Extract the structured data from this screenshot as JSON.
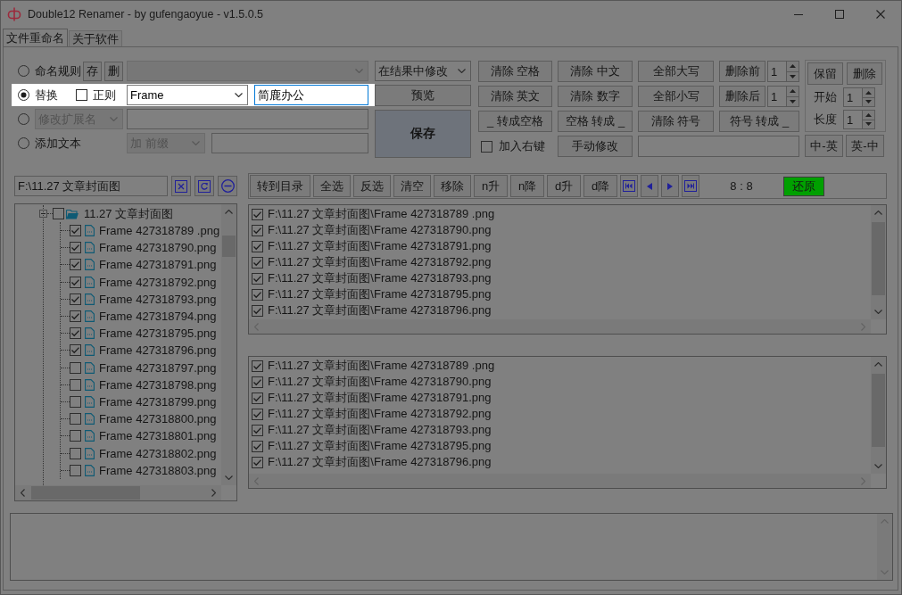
{
  "window": {
    "title": "Double12 Renamer - by gufengaoyue - v1.5.0.5"
  },
  "tabs": [
    {
      "label": "文件重命名",
      "selected": true
    },
    {
      "label": "关于软件",
      "selected": false
    }
  ],
  "rules": [
    {
      "kind": "preset",
      "label": "命名规则",
      "selected": false,
      "highlighted": false,
      "buttons": [
        "存",
        "删"
      ],
      "combo": {
        "disabled": true
      }
    },
    {
      "kind": "replace",
      "label": "替换",
      "selected": true,
      "highlighted": true,
      "regex": {
        "label": "正则",
        "checked": false
      },
      "find": {
        "value": "Frame"
      },
      "replace_with": {
        "value": "简鹿办公",
        "focused": true
      }
    },
    {
      "kind": "extension",
      "selected": false,
      "highlighted": false,
      "mode": {
        "value": "修改扩展名",
        "disabled": true
      }
    },
    {
      "kind": "add_text",
      "label": "添加文本",
      "selected": false,
      "highlighted": false,
      "position": {
        "value": "加 前缀",
        "disabled": true
      }
    }
  ],
  "scope": {
    "value": "在结果中修改"
  },
  "preview_button": {
    "label": "预览"
  },
  "save_button": {
    "label": "保存"
  },
  "actions": [
    {
      "kind": "button",
      "label": "清除 空格"
    },
    {
      "kind": "button",
      "label": "清除 中文"
    },
    {
      "kind": "button",
      "label": "全部大写"
    },
    {
      "kind": "spin_button",
      "label": "删除前",
      "value": "1"
    },
    {
      "kind": "button",
      "label": "清除 英文"
    },
    {
      "kind": "button",
      "label": "清除 数字"
    },
    {
      "kind": "button",
      "label": "全部小写"
    },
    {
      "kind": "spin_button",
      "label": "删除后",
      "value": "1"
    },
    {
      "kind": "button",
      "label": "_ 转成空格"
    },
    {
      "kind": "button",
      "label": "空格 转成 _"
    },
    {
      "kind": "button",
      "label": "清除 符号"
    },
    {
      "kind": "button",
      "label": "符号 转成 _"
    },
    {
      "kind": "checkbox",
      "label": "加入右键",
      "checked": false
    },
    {
      "kind": "button",
      "label": "手动修改"
    },
    {
      "kind": "input"
    }
  ],
  "substring": {
    "buttons": [
      {
        "label": "保留"
      },
      {
        "label": "删除"
      }
    ],
    "fields": [
      {
        "label": "开始",
        "value": "1"
      },
      {
        "label": "长度",
        "value": "1"
      }
    ]
  },
  "translate_buttons": [
    {
      "label": "中-英"
    },
    {
      "label": "英-中"
    }
  ],
  "folder": {
    "path": "F:\\11.27 文章封面图"
  },
  "tree": {
    "label": "11.27 文章封面图",
    "checked": false,
    "expanded": true,
    "children": [
      {
        "label": "Frame 427318789 .png",
        "checked": true
      },
      {
        "label": "Frame 427318790.png",
        "checked": true
      },
      {
        "label": "Frame 427318791.png",
        "checked": true
      },
      {
        "label": "Frame 427318792.png",
        "checked": true
      },
      {
        "label": "Frame 427318793.png",
        "checked": true
      },
      {
        "label": "Frame 427318794.png",
        "checked": true
      },
      {
        "label": "Frame 427318795.png",
        "checked": true
      },
      {
        "label": "Frame 427318796.png",
        "checked": true
      },
      {
        "label": "Frame 427318797.png",
        "checked": false
      },
      {
        "label": "Frame 427318798.png",
        "checked": false
      },
      {
        "label": "Frame 427318799.png",
        "checked": false
      },
      {
        "label": "Frame 427318800.png",
        "checked": false
      },
      {
        "label": "Frame 427318801.png",
        "checked": false
      },
      {
        "label": "Frame 427318802.png",
        "checked": false
      },
      {
        "label": "Frame 427318803.png",
        "checked": false
      }
    ]
  },
  "list_toolbar": {
    "buttons": [
      "转到目录",
      "全选",
      "反选",
      "清空",
      "移除",
      "n升",
      "n降",
      "d升",
      "d降"
    ],
    "counter": "8 : 8",
    "restore_button": {
      "label": "还原"
    }
  },
  "source_list": {
    "items": [
      {
        "path": "F:\\11.27 文章封面图\\Frame 427318789 .png",
        "checked": true
      },
      {
        "path": "F:\\11.27 文章封面图\\Frame 427318790.png",
        "checked": true
      },
      {
        "path": "F:\\11.27 文章封面图\\Frame 427318791.png",
        "checked": true
      },
      {
        "path": "F:\\11.27 文章封面图\\Frame 427318792.png",
        "checked": true
      },
      {
        "path": "F:\\11.27 文章封面图\\Frame 427318793.png",
        "checked": true
      },
      {
        "path": "F:\\11.27 文章封面图\\Frame 427318795.png",
        "checked": true
      },
      {
        "path": "F:\\11.27 文章封面图\\Frame 427318796.png",
        "checked": true
      }
    ]
  },
  "result_list": {
    "items": [
      {
        "path": "F:\\11.27 文章封面图\\Frame 427318789 .png",
        "checked": true
      },
      {
        "path": "F:\\11.27 文章封面图\\Frame 427318790.png",
        "checked": true
      },
      {
        "path": "F:\\11.27 文章封面图\\Frame 427318791.png",
        "checked": true
      },
      {
        "path": "F:\\11.27 文章封面图\\Frame 427318792.png",
        "checked": true
      },
      {
        "path": "F:\\11.27 文章封面图\\Frame 427318793.png",
        "checked": true
      },
      {
        "path": "F:\\11.27 文章封面图\\Frame 427318795.png",
        "checked": true
      },
      {
        "path": "F:\\11.27 文章封面图\\Frame 427318796.png",
        "checked": true
      }
    ]
  }
}
